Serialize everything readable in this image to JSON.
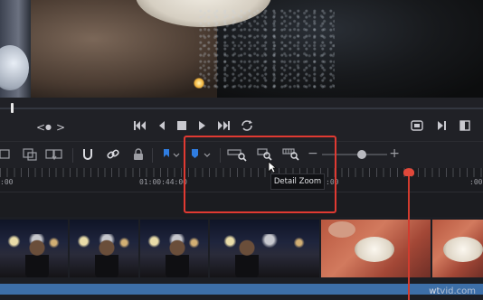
{
  "timeline": {
    "timecodes": [
      ":00",
      "01:00:44:00",
      ":00",
      ":00"
    ]
  },
  "toolbar": {
    "tooltip": "Detail Zoom"
  },
  "viewer": {
    "nav_left": "<",
    "nav_dot": "●",
    "nav_right": ">"
  },
  "colors": {
    "accent": "#e03a32",
    "playhead": "#d23b2e",
    "flag_blue": "#2f7de1",
    "audio_track": "#3d6fa8"
  },
  "icons": [
    "skip-to-start-icon",
    "step-back-icon",
    "stop-icon",
    "play-icon",
    "skip-to-end-icon",
    "loop-icon",
    "snapping-icon",
    "link-icon",
    "lock-icon",
    "flag-icon",
    "marker-icon",
    "full-extent-zoom-icon",
    "detail-zoom-icon",
    "custom-zoom-icon"
  ],
  "watermark": {
    "part1": "wt",
    "part2": "vid.com"
  }
}
